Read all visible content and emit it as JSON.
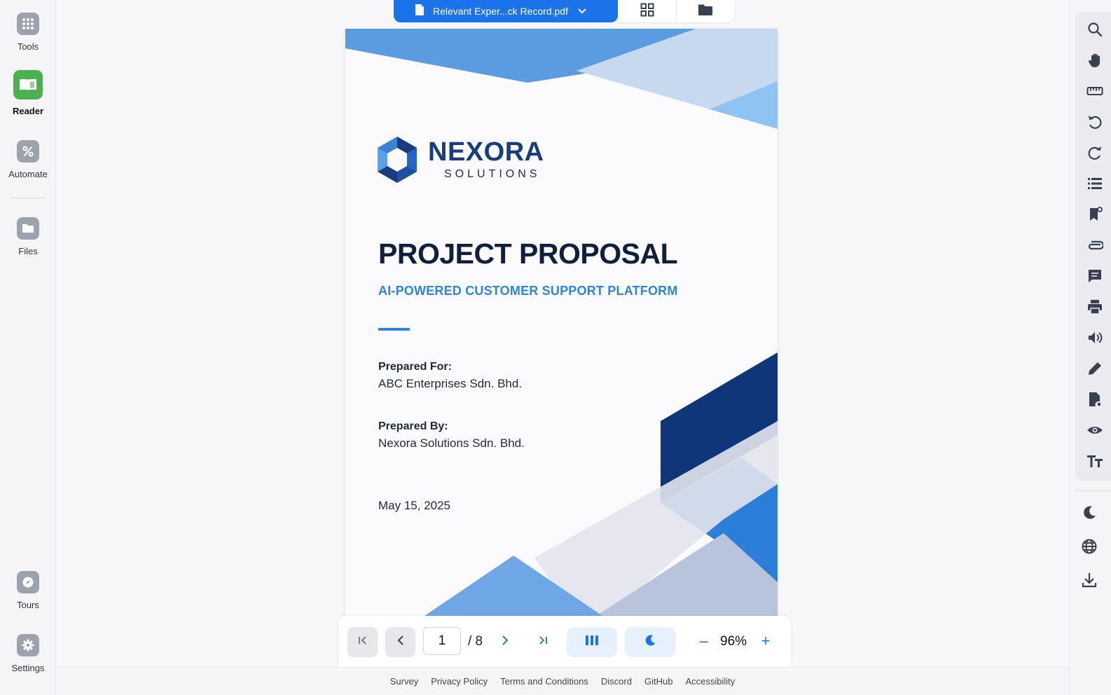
{
  "left_sidebar": {
    "items": [
      {
        "label": "Tools",
        "icon": "grid-dots-icon"
      },
      {
        "label": "Reader",
        "icon": "book-open-icon",
        "active": true
      },
      {
        "label": "Automate",
        "icon": "automate-icon"
      },
      {
        "label": "Files",
        "icon": "folder-icon"
      },
      {
        "label": "Tours",
        "icon": "compass-icon"
      },
      {
        "label": "Settings",
        "icon": "gear-icon"
      }
    ]
  },
  "tabs": {
    "file_name": "Relevant Exper...ck Record.pdf",
    "views": [
      "grid-view-icon",
      "folder-view-icon"
    ]
  },
  "document": {
    "brand": "NEXORA",
    "brand_sub": "SOLUTIONS",
    "title": "PROJECT PROPOSAL",
    "subtitle": "AI-POWERED CUSTOMER SUPPORT PLATFORM",
    "prepared_for_label": "Prepared For:",
    "prepared_for": "ABC Enterprises Sdn. Bhd.",
    "prepared_by_label": "Prepared By:",
    "prepared_by": "Nexora Solutions Sdn. Bhd.",
    "date": "May 15, 2025"
  },
  "navigation": {
    "current_page": "1",
    "total_pages": "/ 8",
    "zoom": "96%",
    "zoom_out": "–",
    "zoom_in": "+"
  },
  "footer": {
    "links": [
      "Survey",
      "Privacy Policy",
      "Terms and Conditions",
      "Discord",
      "GitHub",
      "Accessibility"
    ]
  },
  "right_sidebar": {
    "tools": [
      "search-icon",
      "hand-pan-icon",
      "ruler-icon",
      "rotate-left-icon",
      "rotate-right-icon",
      "list-icon",
      "bookmark-icon",
      "attachment-icon",
      "comment-icon",
      "print-icon",
      "speaker-icon",
      "pencil-icon",
      "document-settings-icon",
      "eye-icon",
      "text-size-icon"
    ],
    "bottom": [
      "moon-icon",
      "globe-icon",
      "download-icon"
    ]
  },
  "colors": {
    "accent": "#1a73e8",
    "reader_active": "#4caf50",
    "brand_dark": "#173d80",
    "brand_blue": "#2b86e0"
  }
}
